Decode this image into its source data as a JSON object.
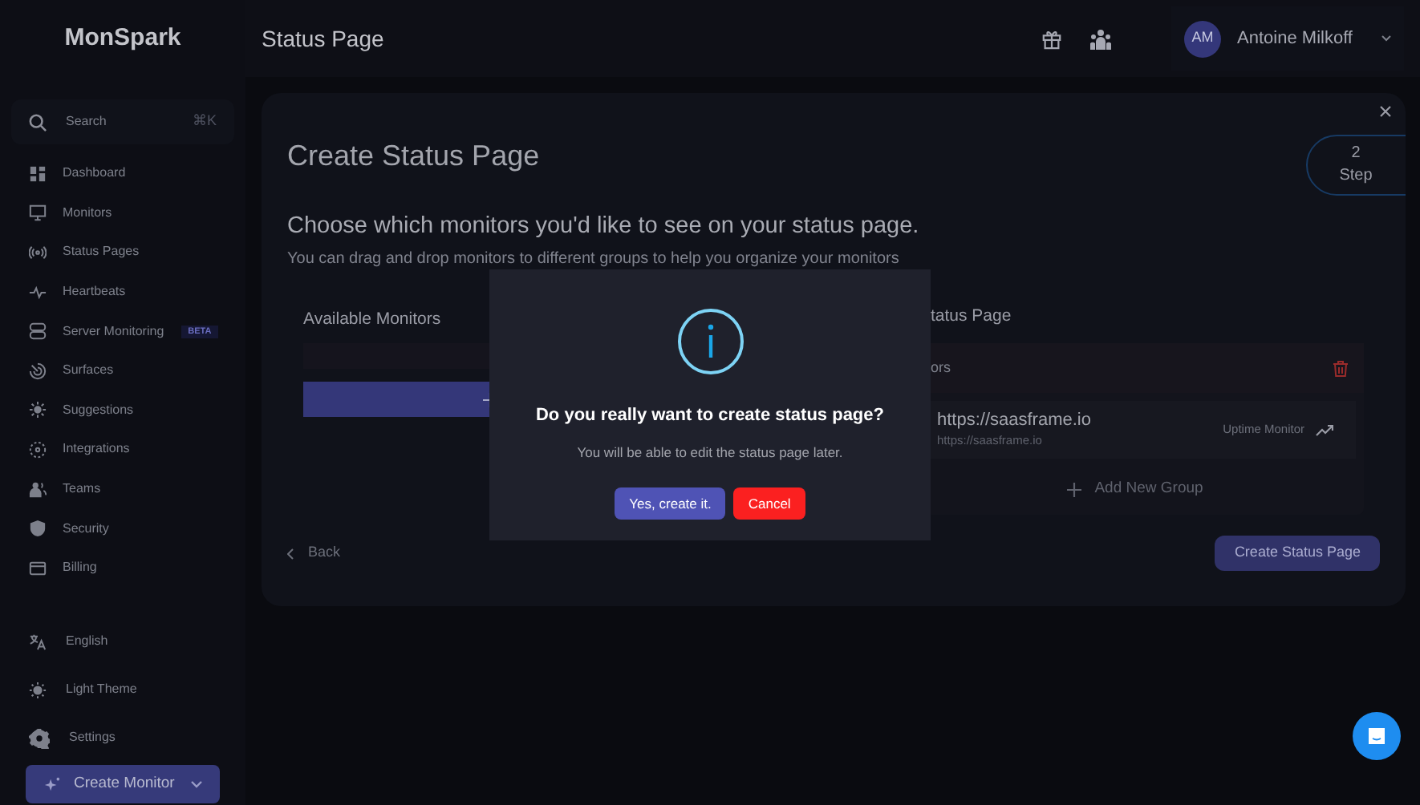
{
  "brand": "MonSpark",
  "header": {
    "title": "Status Page",
    "user": {
      "initials": "AM",
      "name": "Antoine Milkoff"
    }
  },
  "sidebar": {
    "search": {
      "placeholder": "Search",
      "shortcut": "⌘K"
    },
    "items": [
      {
        "label": "Dashboard"
      },
      {
        "label": "Monitors"
      },
      {
        "label": "Status Pages"
      },
      {
        "label": "Heartbeats"
      },
      {
        "label": "Server Monitoring",
        "badge": "BETA"
      },
      {
        "label": "Surfaces"
      },
      {
        "label": "Suggestions"
      },
      {
        "label": "Integrations"
      },
      {
        "label": "Teams"
      },
      {
        "label": "Security"
      },
      {
        "label": "Billing"
      }
    ],
    "bottom_items": [
      {
        "label": "English"
      },
      {
        "label": "Light Theme"
      },
      {
        "label": "Settings"
      }
    ],
    "create_button": "Create Monitor"
  },
  "wizard": {
    "title": "Create Status Page",
    "step": {
      "number": "2",
      "label": "Step"
    },
    "heading": "Choose which monitors you'd like to see on your status page.",
    "description": "You can drag and drop monitors to different groups to help you organize your monitors",
    "available_title": "Available Monitors",
    "selected_title": "tatus Page",
    "group": {
      "name": "ors",
      "monitors": [
        {
          "name": "https://saasframe.io",
          "url": "https://saasframe.io",
          "type": "Uptime Monitor"
        }
      ]
    },
    "add_group": "Add New Group",
    "back": "Back",
    "submit": "Create Status Page"
  },
  "dialog": {
    "title": "Do you really want to create status page?",
    "message": "You will be able to edit the status page later.",
    "confirm": "Yes, create it.",
    "cancel": "Cancel"
  }
}
